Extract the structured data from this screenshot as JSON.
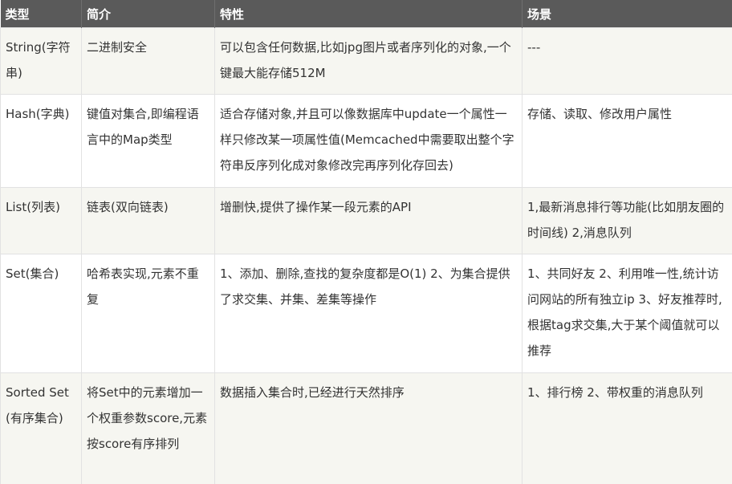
{
  "table": {
    "headers": [
      "类型",
      "简介",
      "特性",
      "场景"
    ],
    "rows": [
      [
        "String(字符串)",
        "二进制安全",
        "可以包含任何数据,比如jpg图片或者序列化的对象,一个键最大能存储512M",
        "---"
      ],
      [
        "Hash(字典)",
        "键值对集合,即编程语言中的Map类型",
        "适合存储对象,并且可以像数据库中update一个属性一样只修改某一项属性值(Memcached中需要取出整个字符串反序列化成对象修改完再序列化存回去)",
        "存储、读取、修改用户属性"
      ],
      [
        "List(列表)",
        "链表(双向链表)",
        "增删快,提供了操作某一段元素的API",
        "1,最新消息排行等功能(比如朋友圈的时间线) 2,消息队列"
      ],
      [
        "Set(集合)",
        "哈希表实现,元素不重复",
        "1、添加、删除,查找的复杂度都是O(1) 2、为集合提供了求交集、并集、差集等操作",
        "1、共同好友 2、利用唯一性,统计访问网站的所有独立ip 3、好友推荐时,根据tag求交集,大于某个阈值就可以推荐"
      ],
      [
        "Sorted Set(有序集合)",
        "将Set中的元素增加一个权重参数score,元素按score有序排列",
        "数据插入集合时,已经进行天然排序",
        "1、排行榜 2、带权重的消息队列"
      ]
    ]
  }
}
